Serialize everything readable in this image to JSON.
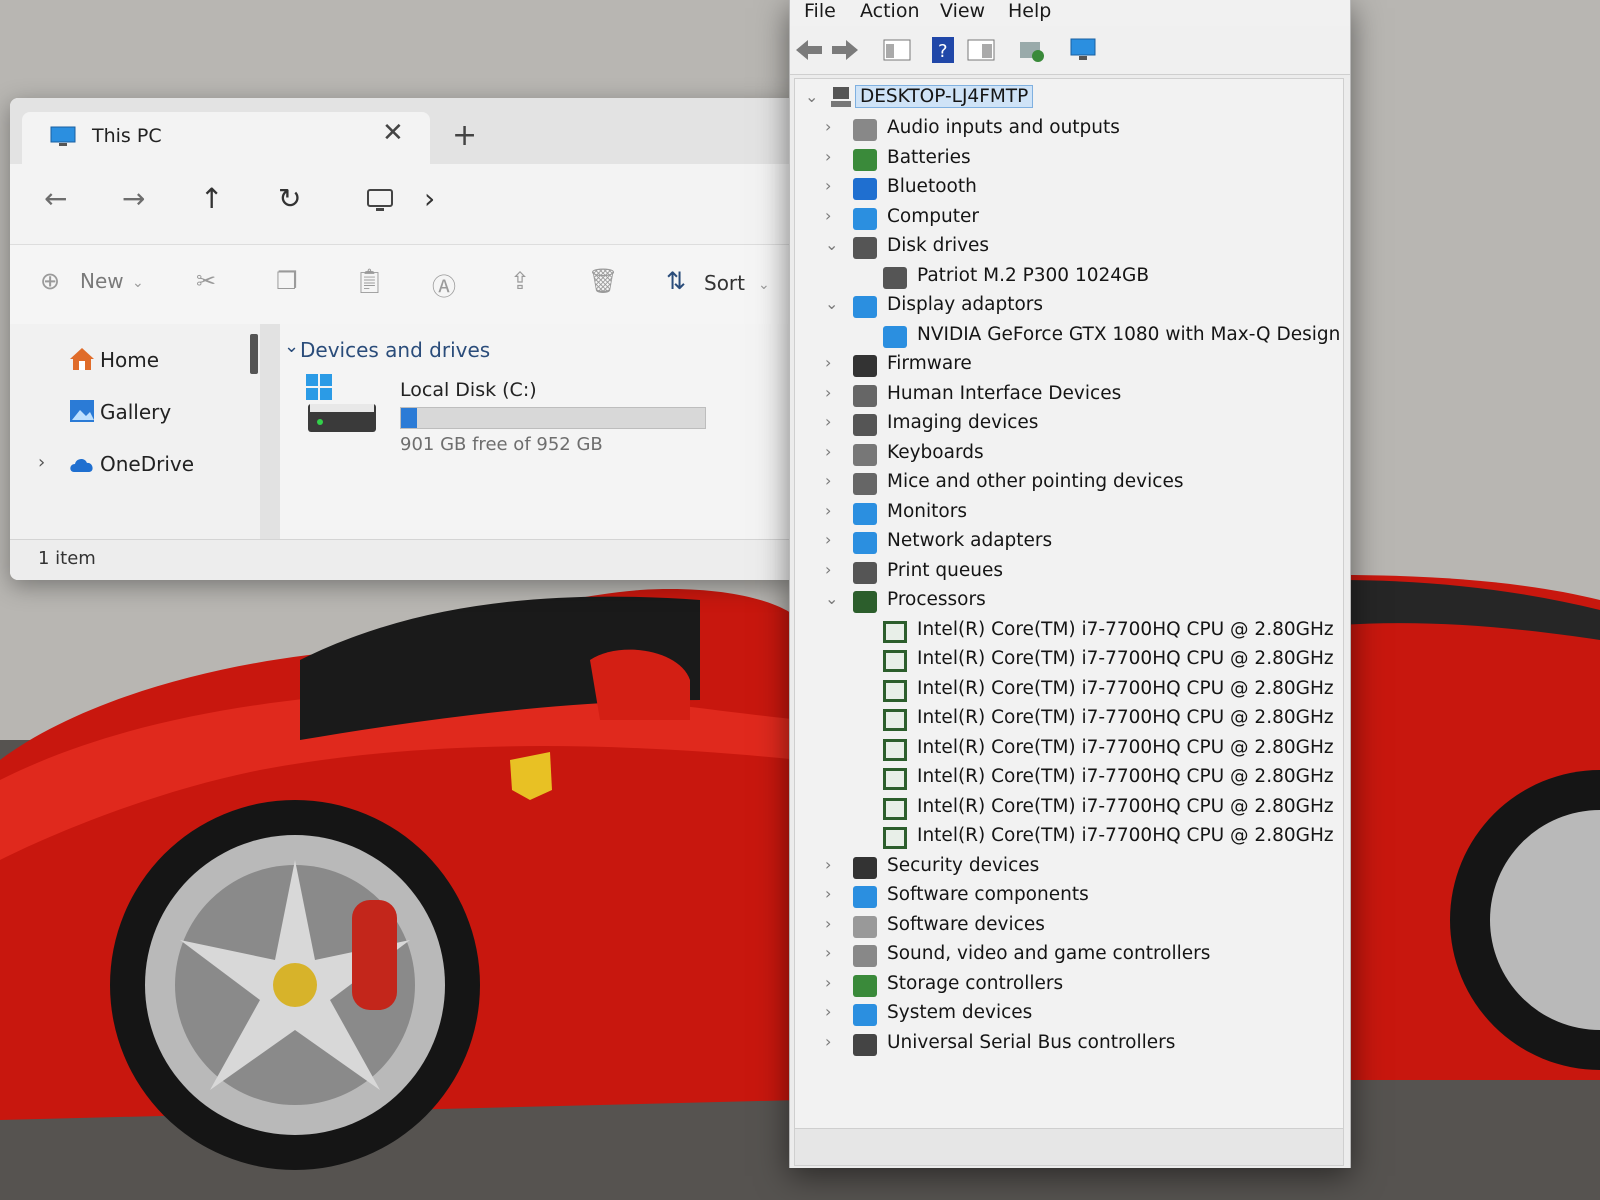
{
  "explorer": {
    "tab_title": "This PC",
    "tab_close": "✕",
    "new_tab": "+",
    "nav": {
      "back": "←",
      "forward": "→",
      "up": "↑",
      "refresh": "↻",
      "path_chevron": "›"
    },
    "commands": {
      "new_label": "New",
      "sort_label": "Sort"
    },
    "sidebar": [
      {
        "label": "Home"
      },
      {
        "label": "Gallery"
      },
      {
        "label": "OneDrive"
      }
    ],
    "group_title": "Devices and drives",
    "drive": {
      "name": "Local Disk (C:)",
      "free_text": "901 GB free of 952 GB",
      "used_fraction": 0.054
    },
    "status": "1 item"
  },
  "devmgr": {
    "menu": [
      "File",
      "Action",
      "View",
      "Help"
    ],
    "root": "DESKTOP-LJ4FMTP",
    "categories": [
      {
        "label": "Audio inputs and outputs",
        "icon": "speaker-icon",
        "expanded": false
      },
      {
        "label": "Batteries",
        "icon": "battery-icon",
        "expanded": false
      },
      {
        "label": "Bluetooth",
        "icon": "bluetooth-icon",
        "expanded": false
      },
      {
        "label": "Computer",
        "icon": "computer-icon",
        "expanded": false
      },
      {
        "label": "Disk drives",
        "icon": "disk-icon",
        "expanded": true,
        "children": [
          "Patriot M.2 P300 1024GB"
        ]
      },
      {
        "label": "Display adaptors",
        "icon": "display-adapter-icon",
        "expanded": true,
        "children": [
          "NVIDIA GeForce GTX 1080 with Max-Q Design"
        ]
      },
      {
        "label": "Firmware",
        "icon": "firmware-icon",
        "expanded": false
      },
      {
        "label": "Human Interface Devices",
        "icon": "hid-icon",
        "expanded": false
      },
      {
        "label": "Imaging devices",
        "icon": "camera-icon",
        "expanded": false
      },
      {
        "label": "Keyboards",
        "icon": "keyboard-icon",
        "expanded": false
      },
      {
        "label": "Mice and other pointing devices",
        "icon": "mouse-icon",
        "expanded": false
      },
      {
        "label": "Monitors",
        "icon": "monitor-icon",
        "expanded": false
      },
      {
        "label": "Network adapters",
        "icon": "network-icon",
        "expanded": false
      },
      {
        "label": "Print queues",
        "icon": "printer-icon",
        "expanded": false
      },
      {
        "label": "Processors",
        "icon": "processor-icon",
        "expanded": true,
        "children": [
          "Intel(R) Core(TM) i7-7700HQ CPU @ 2.80GHz",
          "Intel(R) Core(TM) i7-7700HQ CPU @ 2.80GHz",
          "Intel(R) Core(TM) i7-7700HQ CPU @ 2.80GHz",
          "Intel(R) Core(TM) i7-7700HQ CPU @ 2.80GHz",
          "Intel(R) Core(TM) i7-7700HQ CPU @ 2.80GHz",
          "Intel(R) Core(TM) i7-7700HQ CPU @ 2.80GHz",
          "Intel(R) Core(TM) i7-7700HQ CPU @ 2.80GHz",
          "Intel(R) Core(TM) i7-7700HQ CPU @ 2.80GHz"
        ]
      },
      {
        "label": "Security devices",
        "icon": "security-icon",
        "expanded": false
      },
      {
        "label": "Software components",
        "icon": "software-component-icon",
        "expanded": false
      },
      {
        "label": "Software devices",
        "icon": "software-device-icon",
        "expanded": false
      },
      {
        "label": "Sound, video and game controllers",
        "icon": "speaker-icon",
        "expanded": false
      },
      {
        "label": "Storage controllers",
        "icon": "storage-icon",
        "expanded": false
      },
      {
        "label": "System devices",
        "icon": "system-icon",
        "expanded": false
      },
      {
        "label": "Universal Serial Bus controllers",
        "icon": "usb-icon",
        "expanded": false
      }
    ]
  },
  "colors": {
    "accent": "#2b7bd6",
    "car_red": "#d41d12",
    "selection": "#cfe3f7"
  }
}
